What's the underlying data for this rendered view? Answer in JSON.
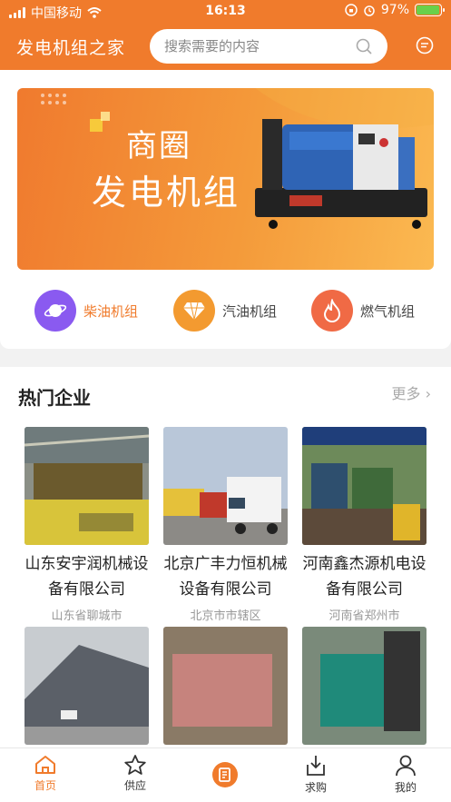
{
  "status": {
    "carrier": "中国移动",
    "time": "16:13",
    "battery": "97%"
  },
  "header": {
    "title": "发电机组之家",
    "search_placeholder": "搜索需要的内容"
  },
  "banner": {
    "line1": "商圈",
    "line2": "发电机组"
  },
  "categories": [
    {
      "label": "柴油机组",
      "icon": "planet-icon",
      "color": "#8a5af0"
    },
    {
      "label": "汽油机组",
      "icon": "diamond-icon",
      "color": "#f39a30"
    },
    {
      "label": "燃气机组",
      "icon": "flame-icon",
      "color": "#f06a45"
    }
  ],
  "hot": {
    "title": "热门企业",
    "more": "更多",
    "enterprises": [
      {
        "name": "山东安宇润机械设备有限公司",
        "city": "山东省聊城市"
      },
      {
        "name": "北京广丰力恒机械设备有限公司",
        "city": "北京市市辖区"
      },
      {
        "name": "河南鑫杰源机电设备有限公司",
        "city": "河南省郑州市"
      }
    ]
  },
  "tabs": [
    {
      "label": "首页",
      "icon": "home-icon"
    },
    {
      "label": "供应",
      "icon": "star-icon"
    },
    {
      "label": "",
      "icon": "publish-icon"
    },
    {
      "label": "求购",
      "icon": "download-box-icon"
    },
    {
      "label": "我的",
      "icon": "user-icon"
    }
  ],
  "colors": {
    "accent": "#f07b2c"
  }
}
